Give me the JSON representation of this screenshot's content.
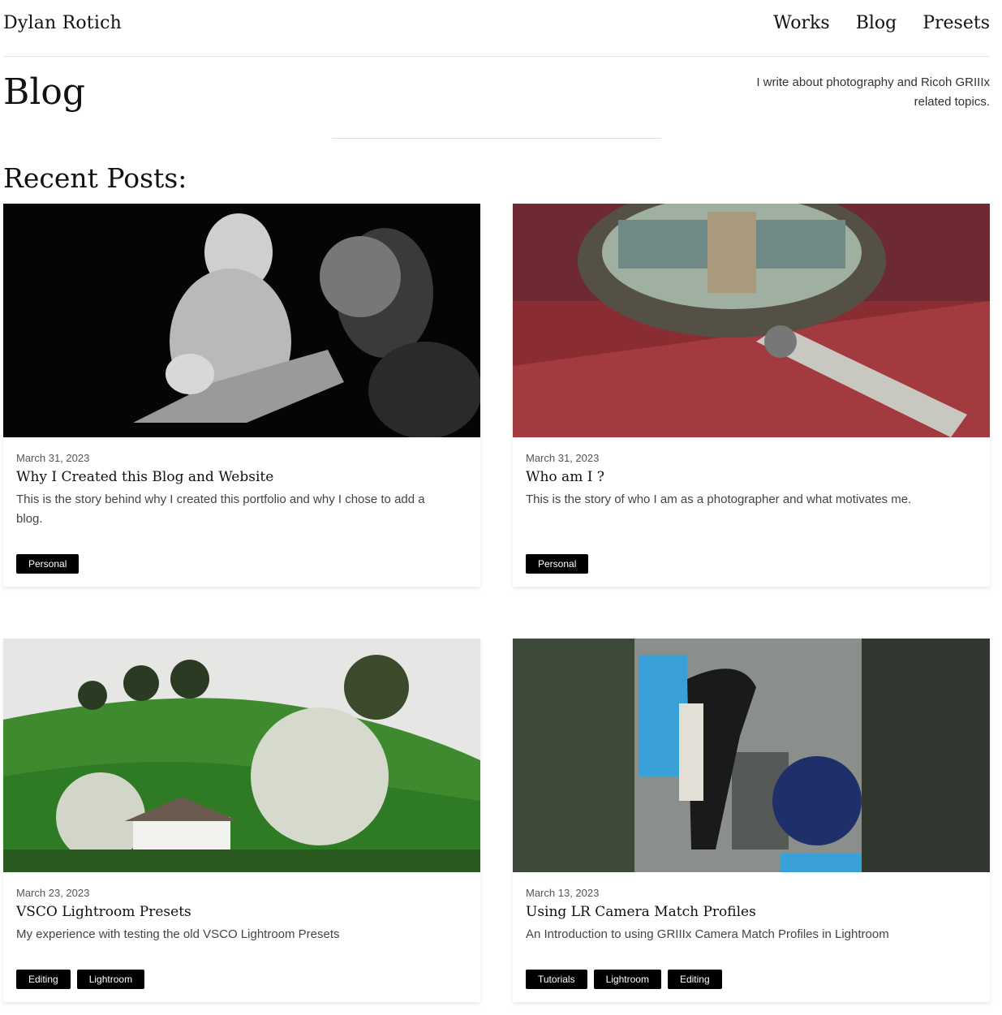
{
  "header": {
    "brand": "Dylan Rotich",
    "nav": [
      "Works",
      "Blog",
      "Presets"
    ]
  },
  "hero": {
    "title": "Blog",
    "description": "I write about photography and Ricoh GRIIIx related topics."
  },
  "section": {
    "title": "Recent Posts:"
  },
  "posts": [
    {
      "date": "March 31, 2023",
      "title": "Why I Created this Blog and Website",
      "excerpt": "This is the story behind why I created this portfolio and why I chose to add a blog.",
      "tags": [
        "Personal"
      ]
    },
    {
      "date": "March 31, 2023",
      "title": "Who am I ?",
      "excerpt": "This is the story of who I am as a photographer and what motivates me.",
      "tags": [
        "Personal"
      ]
    },
    {
      "date": "March 23, 2023",
      "title": "VSCO Lightroom Presets",
      "excerpt": "My experience with testing the old VSCO Lightroom Presets",
      "tags": [
        "Editing",
        "Lightroom"
      ]
    },
    {
      "date": "March 13, 2023",
      "title": "Using LR Camera Match Profiles",
      "excerpt": "An Introduction to using GRIIIx Camera Match Profiles in Lightroom",
      "tags": [
        "Tutorials",
        "Lightroom",
        "Editing"
      ]
    }
  ]
}
